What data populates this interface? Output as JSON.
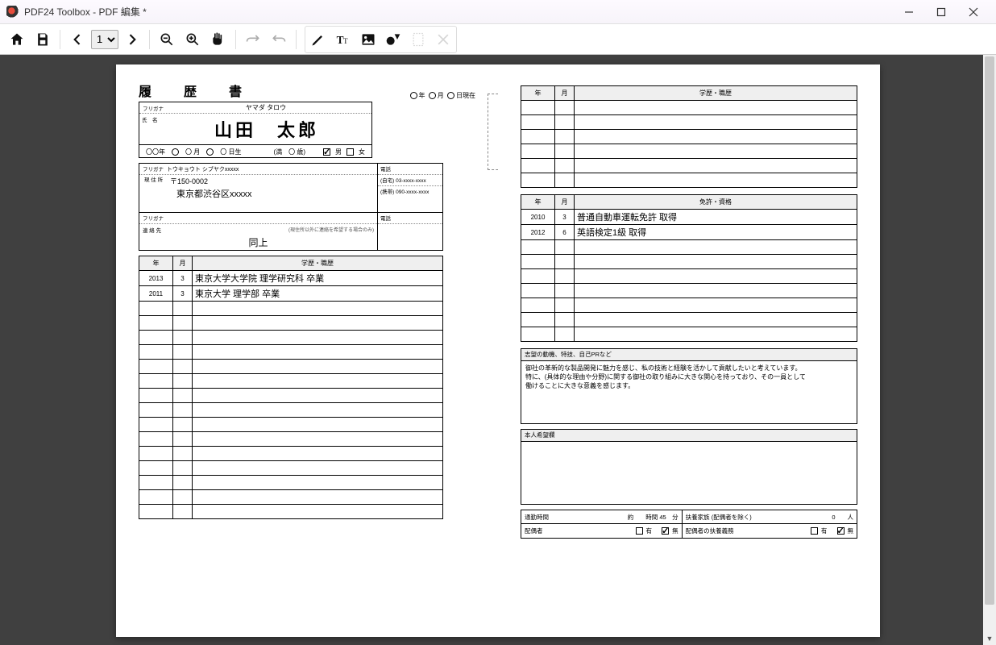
{
  "window": {
    "title": "PDF24 Toolbox - PDF 編集 *"
  },
  "toolbar": {
    "page_current": "1"
  },
  "resume": {
    "title": "履　歴　書",
    "date_labels": {
      "year": "年",
      "month": "月",
      "day": "日現在"
    },
    "furigana_label": "フリガナ",
    "name_label": "氏　名",
    "furigana": "ヤマダ タロウ",
    "name": "山田　太郎",
    "birth_year_label": "〇〇年",
    "birth_month_label": "〇 月",
    "birth_day_label": "〇 日生",
    "age_label": "(満　〇 歳)",
    "gender_m": "男",
    "gender_f": "女",
    "addr_furigana": "トウキョウト シブヤクxxxxx",
    "postal": "〒150-0002",
    "address": "東京都渋谷区xxxxx",
    "addr_label": "現 住 所",
    "tel_label": "電話",
    "tel_home_label": "(自宅)",
    "tel_home": "03-xxxx-xxxx",
    "tel_mobile_label": "(携帯)",
    "tel_mobile": "090-xxxx-xxxx",
    "contact_label": "連 絡 先",
    "contact_note": "(現住所以外に連絡を希望する場合のみ)",
    "contact_same": "同上",
    "table_year": "年",
    "table_month": "月",
    "edu_header": "学歴・職歴",
    "education": [
      {
        "year": "2013",
        "month": "3",
        "text": "東京大学大学院 理学研究科 卒業"
      },
      {
        "year": "2011",
        "month": "3",
        "text": "東京大学 理学部 卒業"
      }
    ],
    "lic_header": "免許・資格",
    "licenses": [
      {
        "year": "2010",
        "month": "3",
        "text": "普通自動車運転免許 取得"
      },
      {
        "year": "2012",
        "month": "6",
        "text": "英語検定1級 取得"
      }
    ],
    "motive_header": "志望の動機、特技、自己PRなど",
    "motive_body": "御社の革新的な製品開発に魅力を感じ、私の技術と経験を活かして貢献したいと考えています。\n特に、(具体的な理由や分野)に関する御社の取り組みに大きな関心を持っており、その一員として\n働けることに大きな意義を感じます。",
    "wish_header": "本人希望欄",
    "commute_label": "通勤時間",
    "commute_val": "約　　時間 45　分",
    "dependents_label": "扶養家族 (配偶者を除く)",
    "dependents_val": "0　　人",
    "spouse_label": "配偶者",
    "spouse_support_label": "配偶者の扶養義務",
    "yes": "有",
    "no": "無"
  }
}
